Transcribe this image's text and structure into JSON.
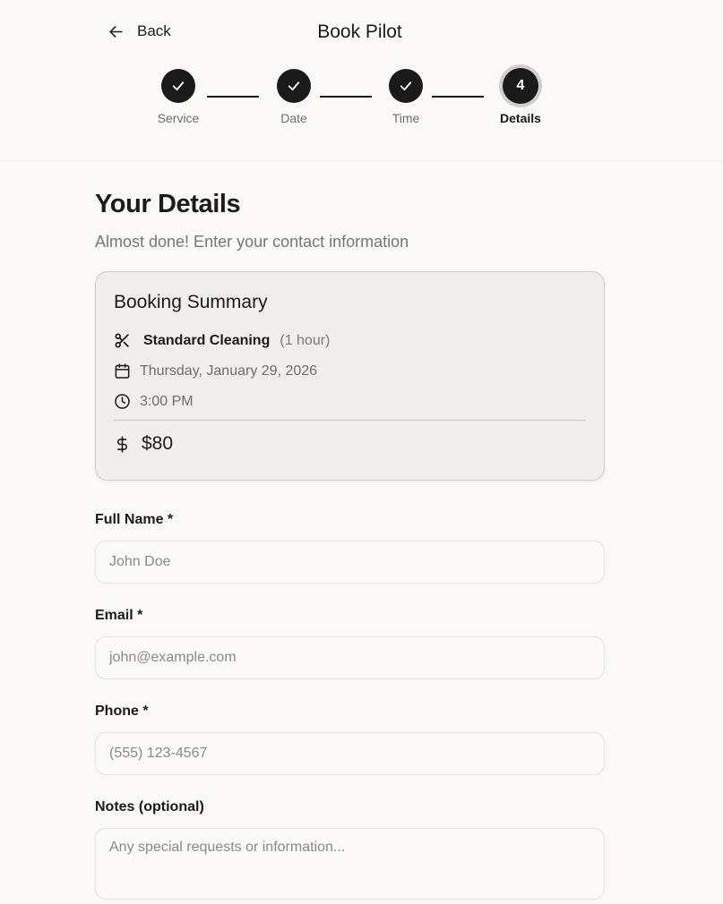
{
  "header": {
    "back_label": "Back",
    "title": "Book Pilot"
  },
  "stepper": {
    "steps": [
      {
        "label": "Service",
        "state": "done"
      },
      {
        "label": "Date",
        "state": "done"
      },
      {
        "label": "Time",
        "state": "done"
      },
      {
        "label": "Details",
        "state": "current",
        "number": "4"
      }
    ]
  },
  "details": {
    "title": "Your Details",
    "subtitle": "Almost done! Enter your contact information"
  },
  "summary": {
    "title": "Booking Summary",
    "service_name": "Standard Cleaning",
    "service_duration": "(1 hour)",
    "date": "Thursday, January 29, 2026",
    "time": "3:00 PM",
    "price": "$80"
  },
  "form": {
    "name": {
      "label": "Full Name *",
      "placeholder": "John Doe"
    },
    "email": {
      "label": "Email *",
      "placeholder": "john@example.com"
    },
    "phone": {
      "label": "Phone *",
      "placeholder": "(555) 123-4567"
    },
    "notes": {
      "label": "Notes (optional)",
      "placeholder": "Any special requests or information..."
    }
  },
  "icons": {
    "back": "arrow-left-icon",
    "check": "check-icon",
    "service": "scissors-icon",
    "date": "calendar-icon",
    "time": "clock-icon",
    "price": "dollar-icon"
  },
  "colors": {
    "accent": "#1a1a1a",
    "background": "#faf9f7",
    "card": "#efeeec",
    "muted_text": "#777777"
  }
}
